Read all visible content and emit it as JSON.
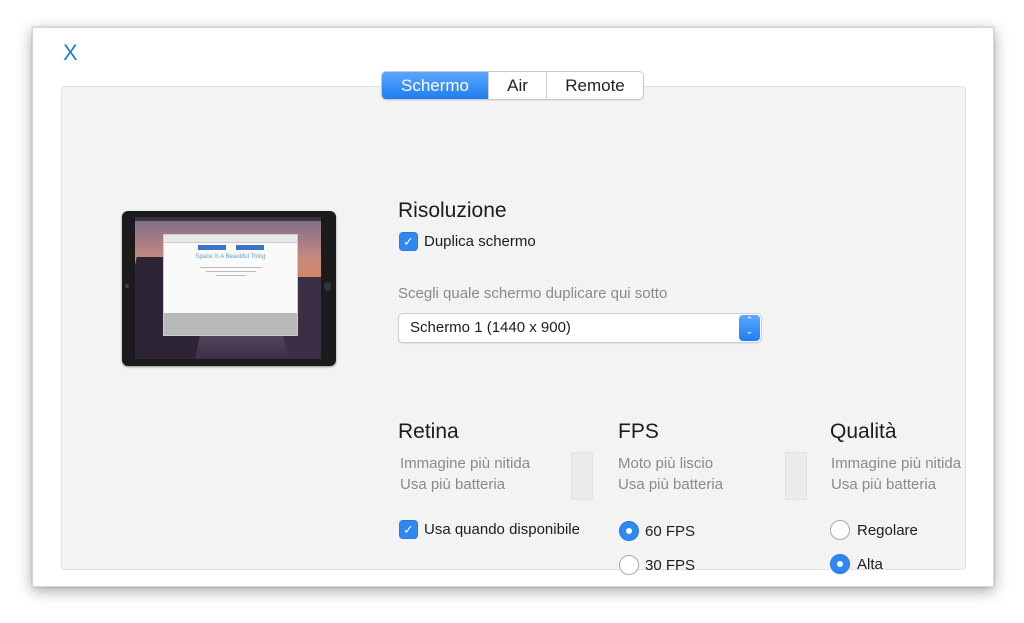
{
  "close_label": "X",
  "tabs": [
    "Schermo",
    "Air",
    "Remote"
  ],
  "active_tab": "Schermo",
  "preview": {
    "title": "Space Is A Beautiful Thing"
  },
  "resolution": {
    "heading": "Risoluzione",
    "duplicate_label": "Duplica schermo",
    "duplicate_checked": true,
    "choose_label": "Scegli quale schermo duplicare qui sotto",
    "screen_select_value": "Schermo 1 (1440 x 900)"
  },
  "retina": {
    "heading": "Retina",
    "desc_line1": "Immagine più nitida",
    "desc_line2": "Usa più batteria",
    "use_label": "Usa quando disponibile",
    "use_checked": true
  },
  "fps": {
    "heading": "FPS",
    "desc_line1": "Moto più liscio",
    "desc_line2": "Usa più batteria",
    "options": [
      "60 FPS",
      "30 FPS"
    ],
    "selected": "60 FPS"
  },
  "quality": {
    "heading": "Qualità",
    "desc_line1": "Immagine più nitida",
    "desc_line2": "Usa più batteria",
    "options": [
      "Regolare",
      "Alta"
    ],
    "selected": "Alta"
  },
  "colors": {
    "accent": "#2f87f3",
    "close": "#1f7fd1"
  },
  "icons": {
    "close": "close-icon",
    "checkmark": "checkmark-icon",
    "select_arrows": "chevron-up-down-icon"
  }
}
